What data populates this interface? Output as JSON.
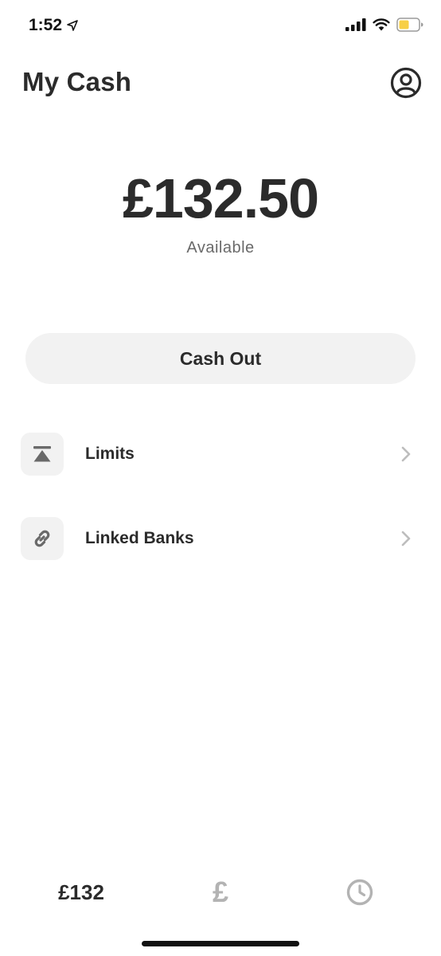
{
  "status_bar": {
    "time": "1:52"
  },
  "header": {
    "title": "My Cash",
    "profile_icon": "profile-icon"
  },
  "balance": {
    "amount": "£132.50",
    "label": "Available"
  },
  "cash_out": {
    "label": "Cash Out"
  },
  "menu": [
    {
      "label": "Limits",
      "icon": "limits-icon"
    },
    {
      "label": "Linked Banks",
      "icon": "link-icon"
    }
  ],
  "tab_bar": {
    "balance_label": "£132",
    "pay_label": "£",
    "activity_icon": "clock-icon"
  },
  "colors": {
    "text": "#2b2b2b",
    "muted": "#6a6a6a",
    "button_bg": "#f2f2f2",
    "inactive_icon": "#b3b3b3",
    "battery": "#f7cf45"
  }
}
